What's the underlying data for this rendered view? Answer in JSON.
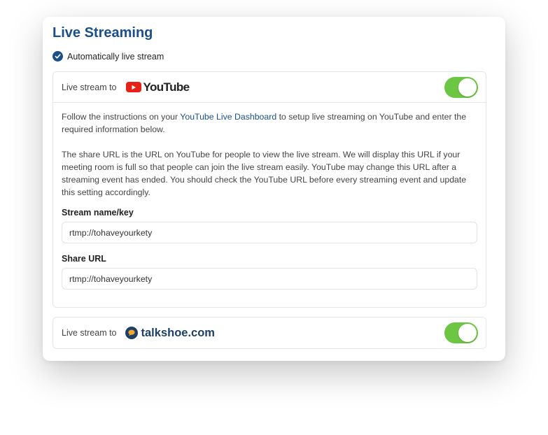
{
  "section": {
    "title": "Live Streaming",
    "auto_stream_label": "Automatically live stream",
    "auto_stream_checked": true
  },
  "youtube": {
    "header_label": "Live stream to",
    "brand": "YouTube",
    "enabled": true,
    "instructions": {
      "prefix": "Follow the instructions on your ",
      "link_text": "YouTube Live Dashboard",
      "suffix": " to setup live streaming on YouTube and enter the required information below."
    },
    "share_note": "The share URL is the URL on YouTube for people to view the live stream. We will display this URL if your meeting room is full so that people can join the live stream easily. YouTube may change this URL after a streaming event has ended. You should check the YouTube URL before every streaming event and update this setting accordingly.",
    "stream_key_label": "Stream name/key",
    "stream_key_value": "rtmp://tohaveyourkety",
    "share_url_label": "Share URL",
    "share_url_value": "rtmp://tohaveyourkety"
  },
  "talkshoe": {
    "header_label": "Live stream to",
    "brand": "talkshoe.com",
    "enabled": true
  },
  "colors": {
    "title": "#1b4f8a",
    "toggle_on": "#6cc644",
    "youtube_red": "#e62117",
    "talkshoe_navy": "#1e3f66"
  }
}
